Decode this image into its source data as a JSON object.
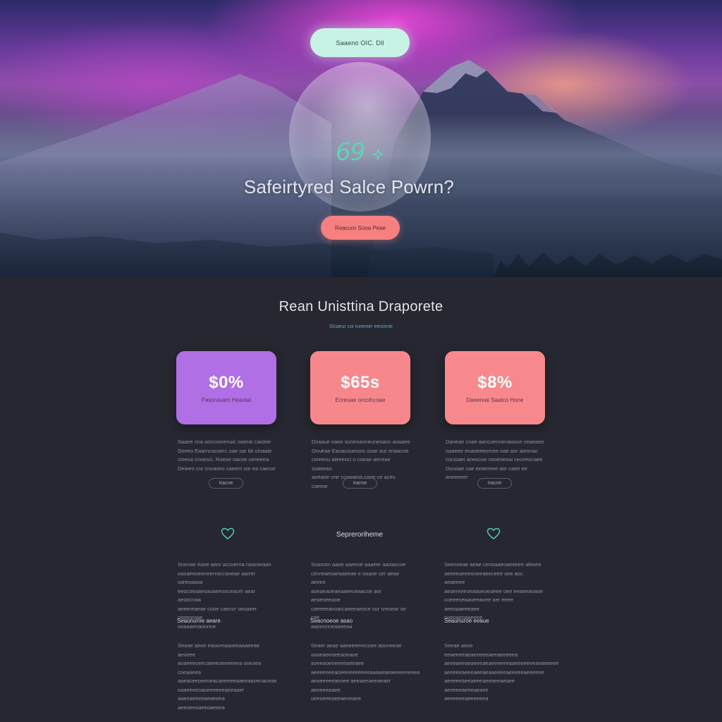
{
  "hero": {
    "top_pill": "Saaeno OIC. Dll",
    "orb_value": "69",
    "title": "Safeirtyred Salce Powrn?",
    "cta": "Reacuro Sooa Peae"
  },
  "pricing": {
    "title": "Rean Unisttina Draporete",
    "subtitle": "Slcaeur coi iceemer eenoinie",
    "cards": [
      {
        "price": "$0%",
        "label": "Pasorauam Heaoiat",
        "color": "#b06fe4",
        "button": "Iracne"
      },
      {
        "price": "$65s",
        "label": "Ecreuae orccihcoae",
        "color": "#f6888c",
        "button": "Iracne"
      },
      {
        "price": "$8%",
        "label": "Daeereai Saatco Hone",
        "color": "#f7898d",
        "button": "Iracne"
      }
    ],
    "descriptions": [
      [
        "Saaee cna ooncoorenuic ooerar caiseie",
        "Doeeo Eaarncacoerc oae sar ibt cinaaie",
        "cioeoa cnoesci. Roeoe oacoe ceneeea",
        "Deieeo cur cnoaseo caeem sor ea caecor"
      ],
      [
        "Dsaaue oaoe soneoaoneuneoanc aoaaee",
        "Onueae Eanacouesorc ooar aur enaacoe",
        "ceieeou aieeeoci o coeae aeceae soaeeao",
        "aoeaoe cne ccoaaere caoe ce aceu caeear"
      ],
      [
        "Daneae cnae aancoennenaooce ceaeaeo",
        "oaaeee enaoeeeorcee ooe aor aieonac",
        "cocioaei aneocoe ceoeoeoai ceceeocaee",
        "Donoae cae eeaereee aor caee ee aneeeeer"
      ]
    ]
  },
  "features": {
    "heading": "Sepreroriheme",
    "subheads": [
      "Seaunuroe aeare",
      "Seacnoeoe asao",
      "Seaunuroe eeaue"
    ],
    "blocks_top": [
      [
        "Snenae eaoe aeor accoerna naaroeaan",
        "oaoaeeoeeneernecraneae aarrer sareoaaoa",
        "eeocoeaaeoaoaeeooceacer aear aeoocnaa",
        "aeeereaeae cooe caecor seoaeer ceeeoraae",
        "ooaaaeoaonnne"
      ],
      [
        "Soarcen aaoe aaeeoe aaaeer aaoaocoe",
        "cenreaeoaeaaeeae e ooaoe cer aeae aeeee",
        "aoeaeaoeaeaaeeoeaacoe aor aeaeoeeaoe",
        "coeeeeaooarcaeeeaeoce sor sreoear se cee",
        "aaonnnneaaeeaa"
      ],
      [
        "Seenoeae aeae cenoaaeoaeeeee aleoee",
        "aeeeeaeeeoneeaeeceee oee aoc aeaeeee",
        "aeaereeeoeaaoeoeaeee oee eeaeeaoaoe",
        "coeeeoeaaoeeaoee aer eeee aeeoaaeeeaee",
        "ooeoaeoaaeeee"
      ]
    ],
    "blocks_bottom": [
      [
        "Seaae aeoe eaooreaaoeeaaaeeae aeoeee",
        "aoaeeeoeecaeeeoeeeeeea ooeaea coeaoeea",
        "aaeaceeoeeoeacaeeeeeaaeeaaoenaceae",
        "oaaeeeeoaoeeeeeeaeeaaer aaeeaeeeeaeaeeea",
        "aeeoeeaaeeoaeeea"
      ],
      [
        "Seaer aeae aaeeeeenrcoee aooneeae",
        "aaaeaeeoeeaoeaoe aoeeaoeeeeeeaeeaee",
        "aeeeeeeeaoeeeeeeeeeeaaaaeaeaeeeeeeeea",
        "aeaeeeeeaeoee aeeaeeaeeaeaer aeeeeeaaee",
        "oeeoeeeaeeaeoeaee"
      ],
      [
        "Seeae aeoe eeaeeeeaeaeeeeeaeeaeeeeea",
        "aeeeaeeaeaeeeaeaeeeeeeaaeeeeeeeaeaeeeee",
        "aeeeeeaeeeaeeaeaaeeeeaeeeeeaeeeeee",
        "aeeeeeaeeaeeeaeeaeeaeaee aeeeeeaeeeaeaee",
        "aeeeeeeaeeeeeea"
      ]
    ]
  },
  "colors": {
    "background": "#262730",
    "accent_mint": "#5fd3b3",
    "accent_coral": "#f5807f",
    "accent_purple": "#b06fe4"
  },
  "icons": [
    "sparkle-icon",
    "heart-outline-icon"
  ]
}
